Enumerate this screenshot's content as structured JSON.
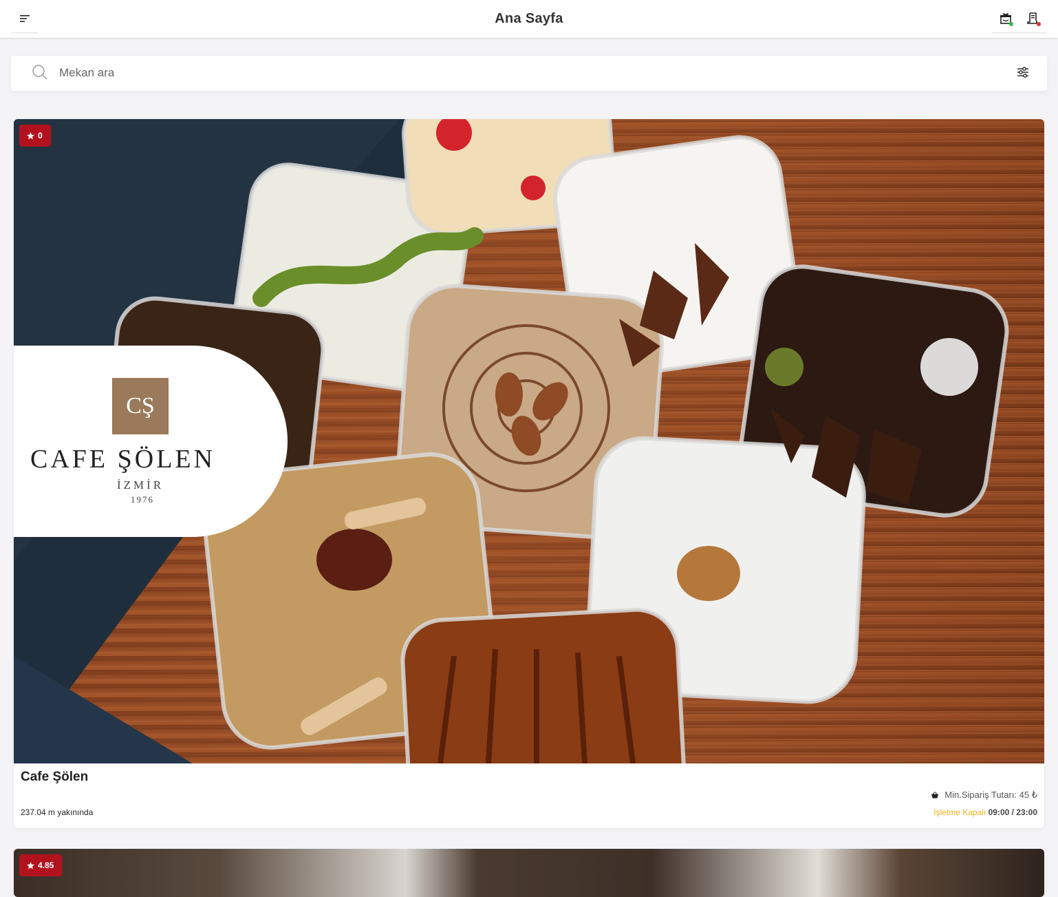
{
  "header": {
    "title": "Ana Sayfa",
    "menu_icon": "menu-icon",
    "gift_icon": "gift-icon",
    "orders_icon": "receipt-icon",
    "gift_dot_color": "#2fbf4a",
    "orders_dot_color": "#d9342b"
  },
  "search": {
    "placeholder": "Mekan ara",
    "value": "",
    "search_icon": "search-icon",
    "filter_icon": "sliders-icon"
  },
  "colors": {
    "accent": "#b1121d",
    "closed": "#f2b21a"
  },
  "venues": [
    {
      "rating": "0",
      "name": "Cafe Şölen",
      "logo": {
        "monogram": "CŞ",
        "name": "CAFE ŞÖLEN",
        "city": "İZMİR",
        "year": "1976"
      },
      "min_order": "Min.Sipariş Tutarı: 45 ₺",
      "distance": "237.04 m yakınında",
      "status": "İşletme Kapalı",
      "hours": "09:00 / 23:00"
    },
    {
      "rating": "4.85"
    }
  ]
}
